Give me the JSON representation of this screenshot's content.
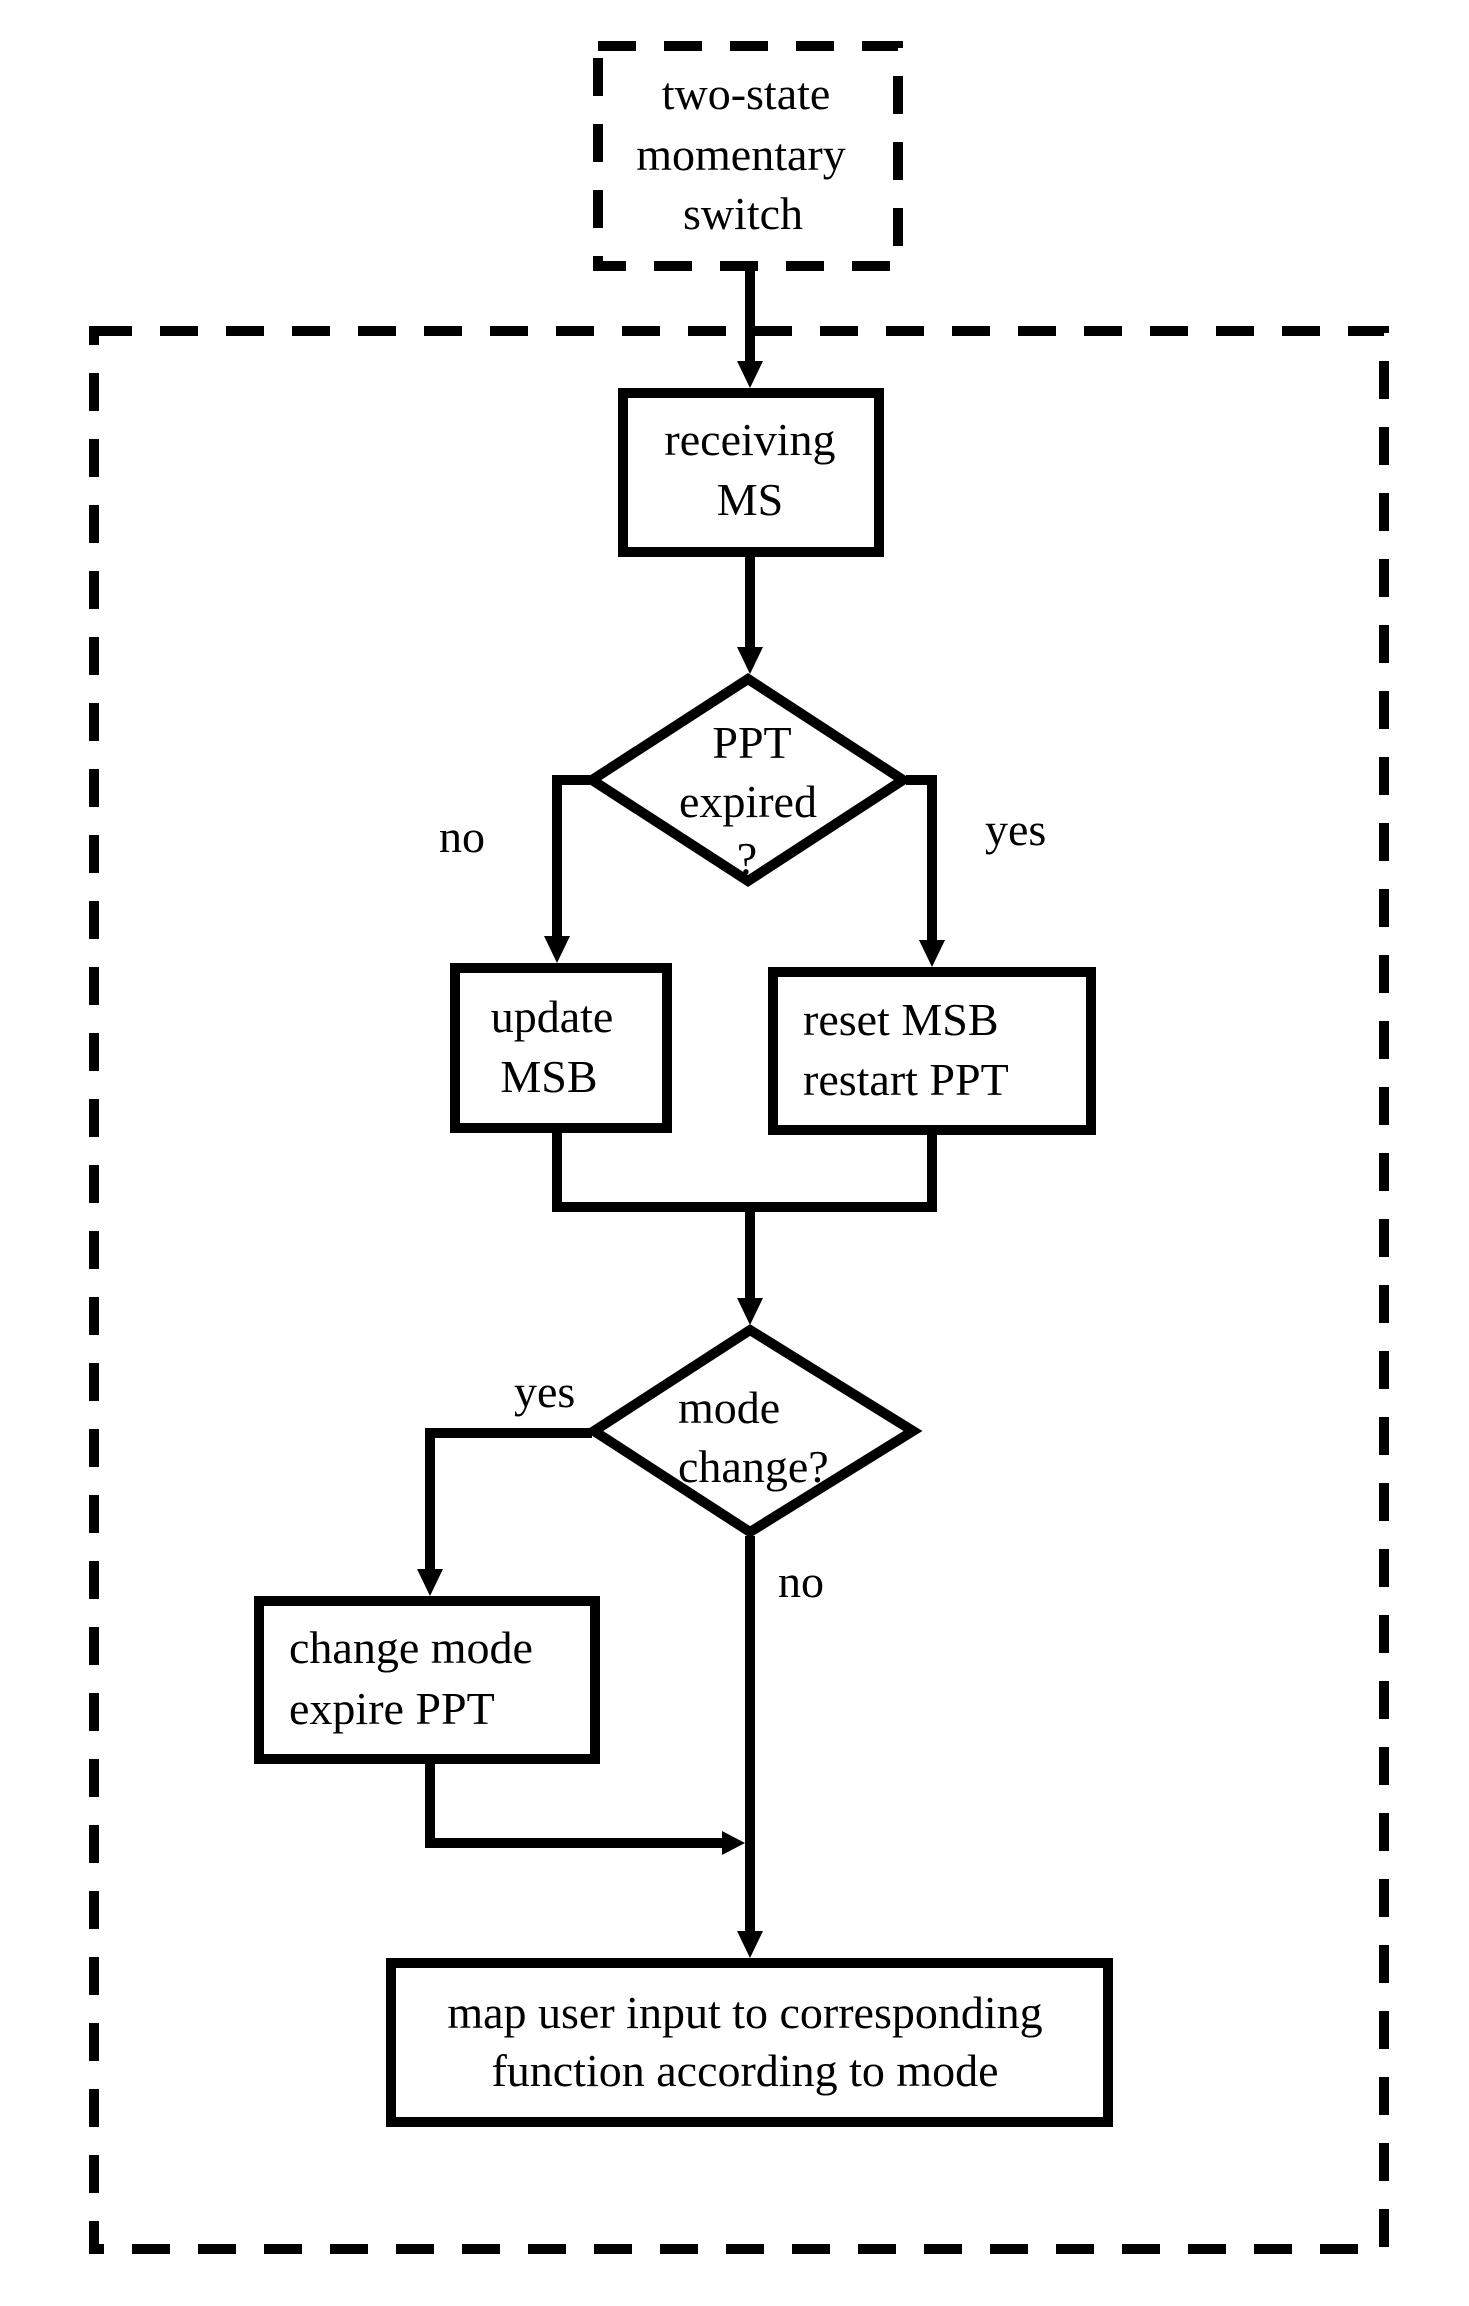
{
  "diagram": {
    "type": "flowchart",
    "external_input": {
      "id": "switch",
      "style": "dashed",
      "lines": [
        "two-state",
        "momentary",
        "switch"
      ]
    },
    "system_boundary": {
      "style": "dashed"
    },
    "nodes": [
      {
        "id": "receiving",
        "shape": "process",
        "lines": [
          "receiving",
          "MS"
        ]
      },
      {
        "id": "ppt_check",
        "shape": "decision",
        "lines": [
          "PPT",
          "expired",
          "?"
        ]
      },
      {
        "id": "update",
        "shape": "process",
        "lines": [
          "update",
          "MSB"
        ]
      },
      {
        "id": "reset",
        "shape": "process",
        "lines": [
          "reset MSB",
          "restart PPT"
        ]
      },
      {
        "id": "mode_check",
        "shape": "decision",
        "lines": [
          "mode",
          "change?"
        ]
      },
      {
        "id": "change_mode",
        "shape": "process",
        "lines": [
          "change mode",
          "expire PPT"
        ]
      },
      {
        "id": "map_input",
        "shape": "process",
        "lines": [
          "map user input to corresponding",
          "function according to mode"
        ]
      }
    ],
    "edges": [
      {
        "from": "switch",
        "to": "receiving",
        "label": ""
      },
      {
        "from": "receiving",
        "to": "ppt_check",
        "label": ""
      },
      {
        "from": "ppt_check",
        "to": "update",
        "label": "no"
      },
      {
        "from": "ppt_check",
        "to": "reset",
        "label": "yes"
      },
      {
        "from": "update",
        "to": "mode_check",
        "label": ""
      },
      {
        "from": "reset",
        "to": "mode_check",
        "label": ""
      },
      {
        "from": "mode_check",
        "to": "change_mode",
        "label": "yes"
      },
      {
        "from": "mode_check",
        "to": "map_input",
        "label": "no"
      },
      {
        "from": "change_mode",
        "to": "map_input",
        "label": ""
      }
    ],
    "edge_labels": {
      "ppt_no": "no",
      "ppt_yes": "yes",
      "mode_yes": "yes",
      "mode_no": "no"
    },
    "colors": {
      "stroke": "#000000",
      "background": "#ffffff"
    }
  }
}
